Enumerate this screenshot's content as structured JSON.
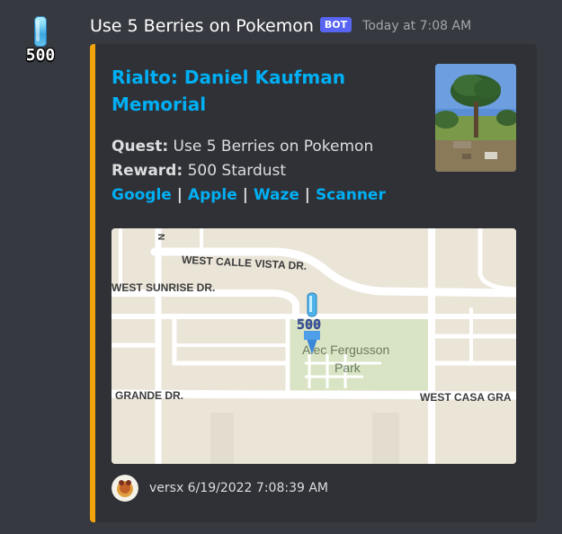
{
  "message": {
    "username": "Use 5 Berries on Pokemon",
    "bot_tag": "BOT",
    "timestamp": "Today at 7:08 AM",
    "avatar_icon": "berry-item-icon",
    "avatar_count": "500"
  },
  "embed": {
    "accent_color": "#f0a30a",
    "title": "Rialto: Daniel Kaufman Memorial",
    "quest_label": "Quest:",
    "quest_value": "Use 5 Berries on Pokemon",
    "reward_label": "Reward:",
    "reward_value": "500 Stardust",
    "links": [
      "Google",
      "Apple",
      "Waze",
      "Scanner"
    ],
    "map": {
      "streets": [
        "WEST CALLE VISTA DR.",
        "WEST SUNRISE DR.",
        "GRANDE DR.",
        "WEST CASA GRA"
      ],
      "park_label_line1": "Alec Fergusson",
      "park_label_line2": "Park",
      "marker_label": "500",
      "side_label": "N"
    },
    "footer": {
      "text": "versx 6/19/2022 7:08:39 AM"
    }
  }
}
